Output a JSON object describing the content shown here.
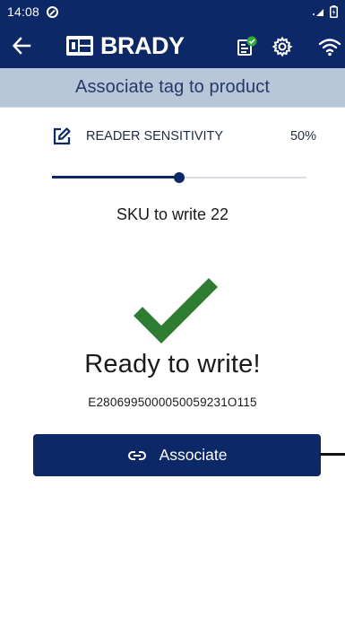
{
  "status_bar": {
    "time": "14:08",
    "dnd_icon": "do-not-disturb-icon",
    "right_icons": [
      "wifi-signal-icon",
      "battery-icon"
    ]
  },
  "app_bar": {
    "back_icon": "arrow-left-icon",
    "brand": "BRADY",
    "icons": [
      "tag-check-icon",
      "gear-icon",
      "wifi-icon"
    ],
    "accent_green": "#2eaa3a"
  },
  "subheader": {
    "title": "Associate tag to product"
  },
  "sensitivity": {
    "label": "READER SENSITIVITY",
    "value_text": "50%",
    "level": 0.5
  },
  "sku_text": "SKU to write 22",
  "status_message": "Ready to write!",
  "tag_id": "E2806995000050059231O115",
  "associate_button": {
    "label": "Associate",
    "icon": "link-icon"
  },
  "colors": {
    "primary": "#0d2866",
    "subheader_bg": "#b8c6d9",
    "check_green": "#2e7d32"
  }
}
